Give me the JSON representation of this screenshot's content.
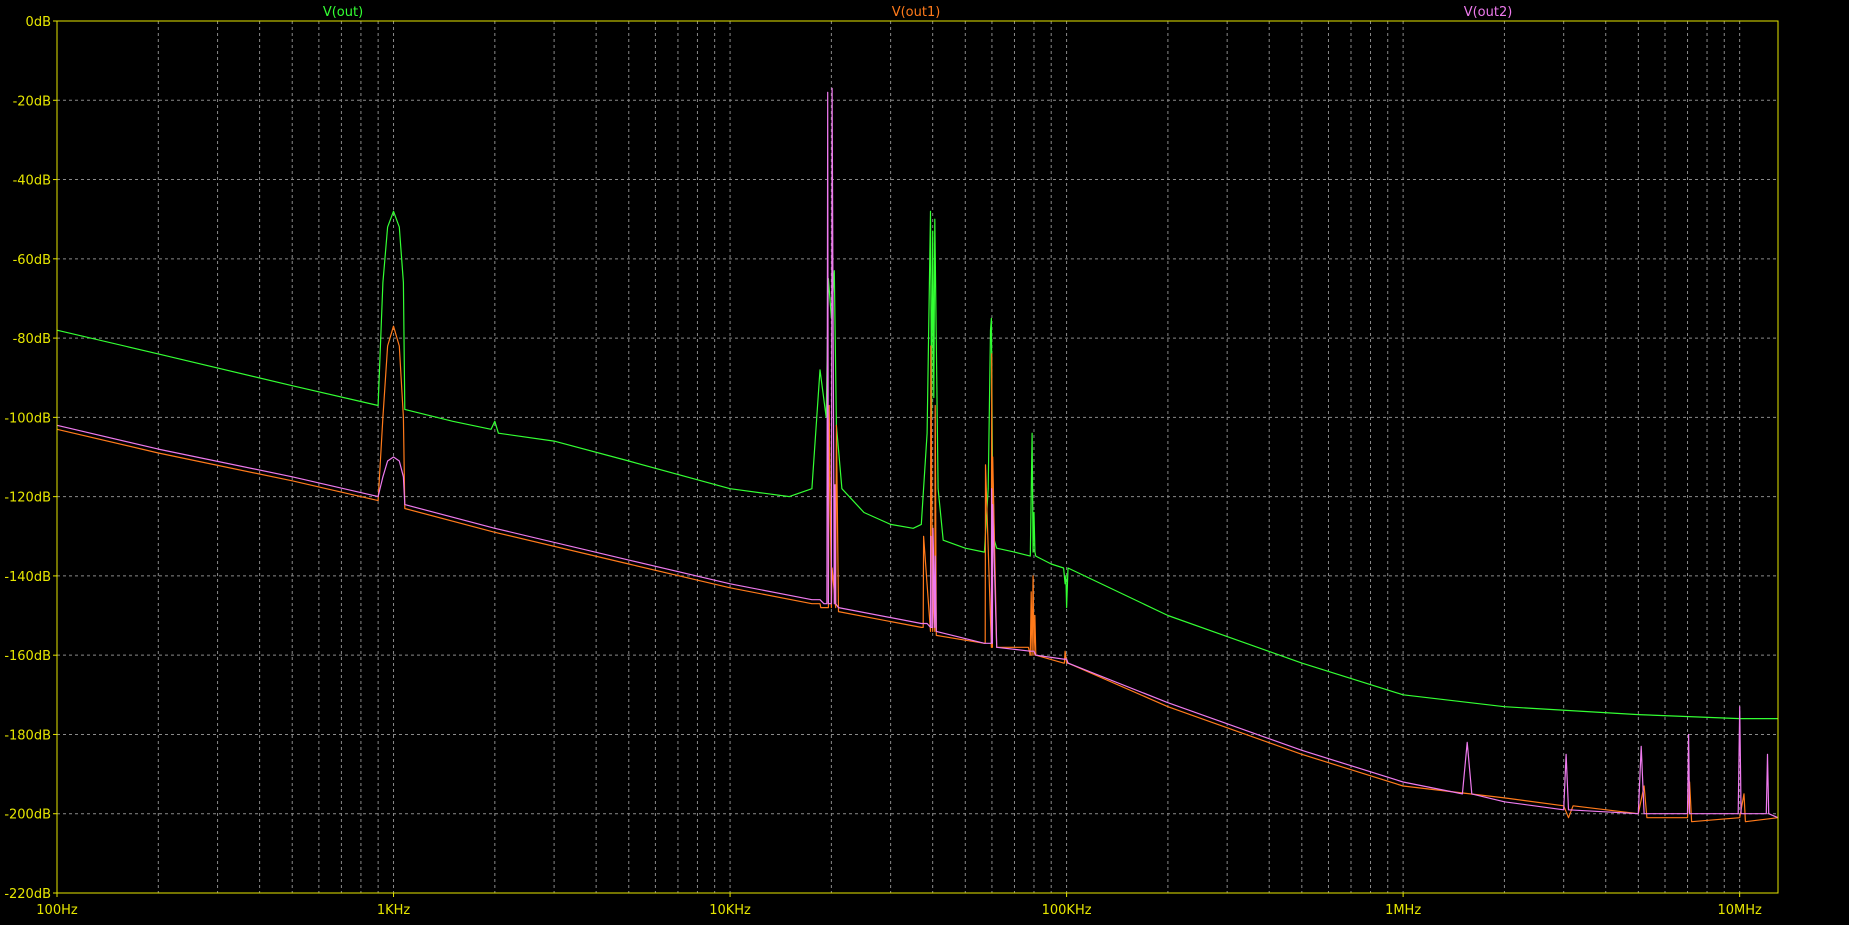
{
  "window": {
    "background": "#000000",
    "frame_color": "#c0c0c0"
  },
  "chart_data": {
    "type": "line",
    "title": "",
    "xlabel": "",
    "ylabel": "",
    "x_scale": "log",
    "xlim_hz": [
      100,
      13000000
    ],
    "ylim_db": [
      -220,
      0
    ],
    "grid": true,
    "grid_color": "#8a8a8a",
    "axis_color": "#e6e600",
    "y_ticks": [
      "0dB",
      "-20dB",
      "-40dB",
      "-60dB",
      "-80dB",
      "-100dB",
      "-120dB",
      "-140dB",
      "-160dB",
      "-180dB",
      "-200dB",
      "-220dB"
    ],
    "y_tick_values": [
      0,
      -20,
      -40,
      -60,
      -80,
      -100,
      -120,
      -140,
      -160,
      -180,
      -200,
      -220
    ],
    "x_ticks": [
      "100Hz",
      "1KHz",
      "10KHz",
      "100KHz",
      "1MHz",
      "10MHz"
    ],
    "x_tick_values": [
      100,
      1000,
      10000,
      100000,
      1000000,
      10000000
    ],
    "series": [
      {
        "name": "V(out)",
        "color": "#33ff33",
        "x": [
          100,
          200,
          500,
          900,
          930,
          960,
          1000,
          1040,
          1070,
          1080,
          1500,
          1950,
          2000,
          2050,
          3000,
          5000,
          10000,
          15000,
          17500,
          18500,
          19300,
          19600,
          20000,
          20400,
          20700,
          21500,
          25000,
          30000,
          35000,
          37000,
          38500,
          39400,
          39700,
          40000,
          40300,
          40600,
          41500,
          43000,
          50000,
          57000,
          58500,
          59400,
          59800,
          60200,
          61000,
          62000,
          70000,
          78000,
          79000,
          79500,
          80000,
          80500,
          81000,
          90000,
          98000,
          99000,
          99500,
          100000,
          101000,
          200000,
          500000,
          1000000,
          2000000,
          5000000,
          10000000,
          13000000
        ],
        "y": [
          -78,
          -84,
          -92,
          -97,
          -66,
          -52,
          -48,
          -52,
          -66,
          -98,
          -101,
          -103,
          -101,
          -104,
          -106,
          -111,
          -118,
          -120,
          -118,
          -88,
          -100,
          -65,
          -75,
          -63,
          -102,
          -118,
          -124,
          -127,
          -128,
          -127,
          -104,
          -48,
          -100,
          -53,
          -95,
          -50,
          -118,
          -131,
          -133,
          -134,
          -118,
          -78,
          -75,
          -110,
          -131,
          -133,
          -134,
          -135,
          -104,
          -134,
          -124,
          -134,
          -135,
          -137,
          -138,
          -142,
          -140,
          -148,
          -138,
          -150,
          -162,
          -170,
          -173,
          -175,
          -176,
          -176
        ]
      },
      {
        "name": "V(out1)",
        "color": "#ff7a1a",
        "x": [
          100,
          200,
          500,
          900,
          930,
          960,
          1000,
          1040,
          1070,
          1080,
          2000,
          5000,
          10000,
          17500,
          18500,
          18600,
          19600,
          19700,
          20000,
          20100,
          20600,
          20700,
          21000,
          37000,
          37500,
          37600,
          39400,
          39500,
          40000,
          40100,
          40600,
          40700,
          41000,
          57000,
          57300,
          57400,
          59800,
          59900,
          60200,
          60300,
          62000,
          77000,
          78000,
          78500,
          79000,
          79500,
          80000,
          80500,
          81000,
          98000,
          98500,
          99000,
          100000,
          101000,
          200000,
          500000,
          1000000,
          2000000,
          3000000,
          3100000,
          3200000,
          5000000,
          5200000,
          5300000,
          7000000,
          7100000,
          7200000,
          10000000,
          10300000,
          10400000,
          13000000
        ],
        "y": [
          -103,
          -109,
          -116,
          -121,
          -100,
          -82,
          -77,
          -82,
          -100,
          -123,
          -129,
          -137,
          -143,
          -147,
          -147,
          -148,
          -148,
          -97,
          -148,
          -138,
          -148,
          -102,
          -149,
          -153,
          -153,
          -130,
          -154,
          -82,
          -154,
          -142,
          -154,
          -97,
          -155,
          -157,
          -157,
          -112,
          -158,
          -84,
          -158,
          -110,
          -158,
          -158,
          -160,
          -144,
          -160,
          -140,
          -160,
          -150,
          -160,
          -162,
          -162,
          -159,
          -162,
          -162,
          -173,
          -185,
          -193,
          -196,
          -198,
          -201,
          -198,
          -200,
          -193,
          -201,
          -201,
          -192,
          -202,
          -201,
          -195,
          -202,
          -201
        ]
      },
      {
        "name": "V(out2)",
        "color": "#ee7aee",
        "x": [
          100,
          200,
          500,
          900,
          930,
          960,
          1000,
          1040,
          1070,
          1080,
          2000,
          5000,
          10000,
          17500,
          18500,
          19000,
          19400,
          19500,
          19600,
          20000,
          20100,
          20400,
          20500,
          20600,
          21000,
          37000,
          38500,
          39400,
          39500,
          39600,
          40000,
          40100,
          40600,
          40700,
          41000,
          57000,
          59000,
          59800,
          59900,
          60200,
          60300,
          62000,
          78000,
          79000,
          80000,
          81000,
          98000,
          99000,
          100000,
          101000,
          200000,
          500000,
          1000000,
          1500000,
          1550000,
          1600000,
          2000000,
          3000000,
          3050000,
          3100000,
          5000000,
          5100000,
          5200000,
          7000000,
          7050000,
          7100000,
          9900000,
          10000000,
          10100000,
          12000000,
          12100000,
          12200000,
          13000000
        ],
        "y": [
          -102,
          -108,
          -115,
          -120,
          -115,
          -111,
          -110,
          -111,
          -115,
          -122,
          -128,
          -136,
          -142,
          -146,
          -146,
          -147,
          -147,
          -18,
          -147,
          -147,
          -17,
          -147,
          -117,
          -147,
          -148,
          -152,
          -152,
          -153,
          -130,
          -153,
          -153,
          -128,
          -153,
          -135,
          -154,
          -157,
          -157,
          -157,
          -118,
          -157,
          -122,
          -158,
          -159,
          -159,
          -159,
          -160,
          -161,
          -161,
          -161,
          -162,
          -172,
          -184,
          -192,
          -195,
          -182,
          -195,
          -197,
          -199,
          -185,
          -199,
          -200,
          -183,
          -200,
          -200,
          -180,
          -200,
          -200,
          -173,
          -200,
          -200,
          -185,
          -200,
          -201
        ]
      }
    ]
  }
}
